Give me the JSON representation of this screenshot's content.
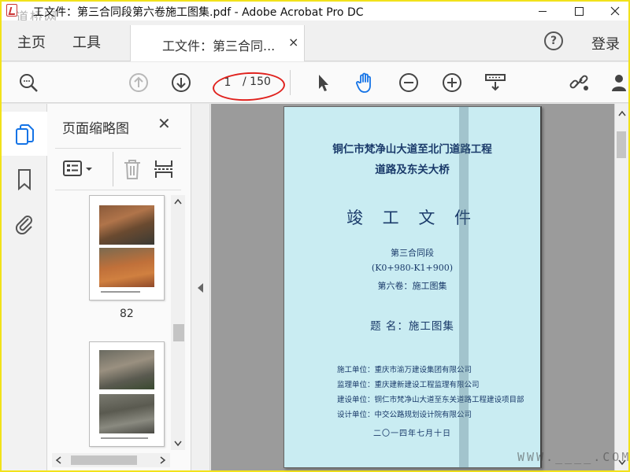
{
  "window": {
    "title": "工文件：第三合同段第六卷施工图集.pdf - Adobe Acrobat Pro DC",
    "watermark": "道桥网"
  },
  "tabs": {
    "home": "主页",
    "tools": "工具",
    "document": "工文件：第三合同...",
    "close": "×"
  },
  "header": {
    "help": "?",
    "login": "登录"
  },
  "toolbar": {
    "current_page": "1",
    "total_pages": "/ 150"
  },
  "thumbnails": {
    "title": "页面缩略图",
    "close": "✕",
    "page_label": "82"
  },
  "document": {
    "title_line1": "铜仁市梵净山大道至北门道路工程",
    "title_line2": "道路及东关大桥",
    "main_title": "竣 工 文 件",
    "section": "第三合同段",
    "chainage": "(K0+980-K1+900)",
    "volume": "第六卷：施工图集",
    "subject": "题  名：施工图集",
    "units": [
      "施工单位：重庆市渝万建设集团有限公司",
      "监理单位：重庆建新建设工程监理有限公司",
      "建设单位：铜仁市梵净山大道至东关道路工程建设项目部",
      "设计单位：中交公路规划设计院有限公司"
    ],
    "date": "二〇一四年七月十日"
  },
  "watermark_bottom": "WWW.____.COM",
  "colors": {
    "accent_blue": "#1473e6",
    "annotation_red": "#e0221e",
    "page_bg": "#c9ecf2"
  }
}
